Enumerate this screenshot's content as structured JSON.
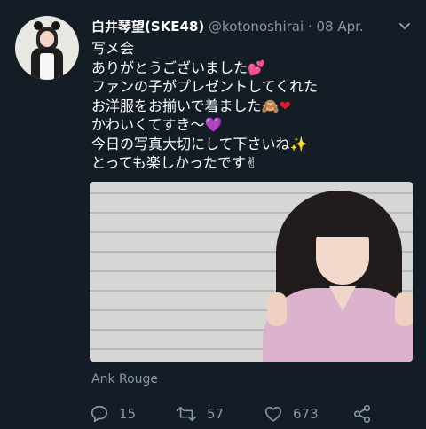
{
  "tweet": {
    "display_name": "白井琴望(SKE48)",
    "handle": "@kotonoshirai",
    "separator": "·",
    "date": "08 Apr.",
    "lines": [
      "写メ会",
      "ありがとうございました",
      "ファンの子がプレゼントしてくれた",
      "お洋服をお揃いで着ました",
      "かわいくてすき〜",
      "今日の写真大切にして下さいね",
      "とっても楽しかったです"
    ],
    "emoji": {
      "line2": "💕",
      "line4": "🙈❤",
      "line5": "💜",
      "line6": "✨",
      "line7": "✌"
    },
    "media_caption": "Ank Rouge",
    "stats": {
      "replies": "15",
      "retweets": "57",
      "likes": "673"
    }
  },
  "icons": {
    "menu": "chevron-down-icon",
    "reply": "reply-icon",
    "retweet": "retweet-icon",
    "like": "heart-icon",
    "share": "share-icon"
  },
  "colors": {
    "background": "#141d26",
    "text": "#ffffff",
    "muted": "#8899a6"
  }
}
